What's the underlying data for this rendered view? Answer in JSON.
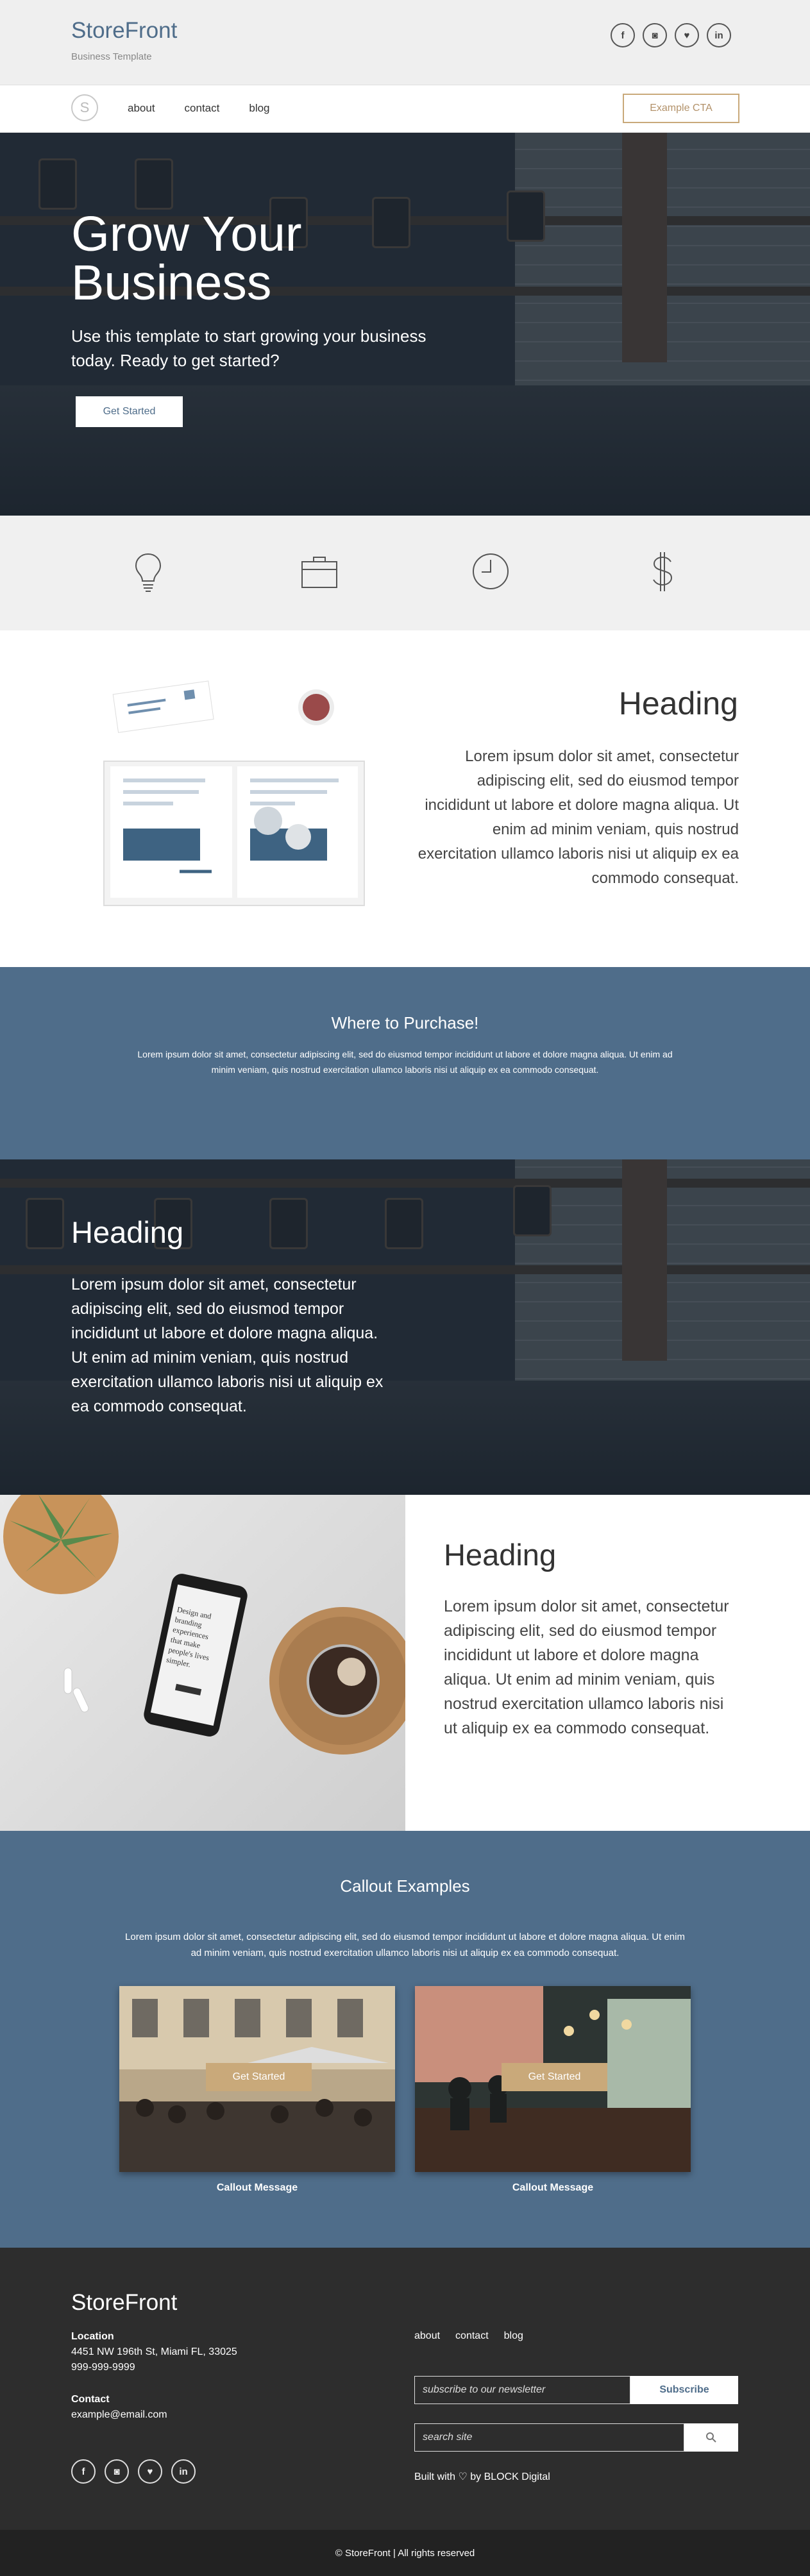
{
  "header": {
    "brand": "StoreFront",
    "tagline": "Business Template",
    "social": [
      {
        "icon": "facebook-icon",
        "glyph": "f"
      },
      {
        "icon": "instagram-icon",
        "glyph": "◙"
      },
      {
        "icon": "twitter-icon",
        "glyph": "♥"
      },
      {
        "icon": "linkedin-icon",
        "glyph": "in"
      }
    ]
  },
  "nav": {
    "logo_letter": "S",
    "links": [
      "about",
      "contact",
      "blog"
    ],
    "cta": "Example CTA"
  },
  "hero": {
    "title": "Grow Your Business",
    "subtitle": "Use this template to start growing your business today. Ready to get started?",
    "button": "Get Started"
  },
  "icons_strip": [
    "lightbulb-icon",
    "briefcase-icon",
    "clock-icon",
    "dollar-icon"
  ],
  "section_one": {
    "heading": "Heading",
    "body": "Lorem ipsum dolor sit amet, consectetur adipiscing elit, sed do eiusmod tempor incididunt ut labore et dolore magna aliqua. Ut enim ad minim veniam, quis nostrud exercitation ullamco laboris nisi ut aliquip ex ea commodo consequat."
  },
  "purchase": {
    "heading": "Where to Purchase!",
    "body": "Lorem ipsum dolor sit amet, consectetur adipiscing elit, sed do eiusmod tempor incididunt ut labore et dolore magna aliqua. Ut enim ad minim veniam, quis nostrud exercitation ullamco laboris nisi ut aliquip ex ea commodo consequat."
  },
  "section_two": {
    "heading": "Heading",
    "body": "Lorem ipsum dolor sit amet, consectetur adipiscing elit, sed do eiusmod tempor incididunt ut labore et dolore magna aliqua. Ut enim ad minim veniam, quis nostrud exercitation ullamco laboris nisi ut aliquip ex ea commodo consequat."
  },
  "section_three": {
    "heading": "Heading",
    "body": "Lorem ipsum dolor sit amet, consectetur adipiscing elit, sed do eiusmod tempor incididunt ut labore et dolore magna aliqua. Ut enim ad minim veniam, quis nostrud exercitation ullamco laboris nisi ut aliquip ex ea commodo consequat."
  },
  "callouts": {
    "heading": "Callout Examples",
    "body": "Lorem ipsum dolor sit amet, consectetur adipiscing elit, sed do eiusmod tempor incididunt ut labore et dolore magna aliqua. Ut enim ad minim veniam, quis nostrud exercitation ullamco laboris nisi ut aliquip ex ea commodo consequat.",
    "cards": [
      {
        "button": "Get Started",
        "message": "Callout Message"
      },
      {
        "button": "Get Started",
        "message": "Callout Message"
      }
    ]
  },
  "footer": {
    "brand": "StoreFront",
    "location_label": "Location",
    "address": "4451 NW 196th St, Miami FL, 33025",
    "phone": "999-999-9999",
    "contact_label": "Contact",
    "email": "example@email.com",
    "links": [
      "about",
      "contact",
      "blog"
    ],
    "newsletter_placeholder": "subscribe to our newsletter",
    "subscribe": "Subscribe",
    "search_placeholder": "search site",
    "built_with": "Built with ♡ by BLOCK Digital",
    "copyright": "© StoreFront | All rights reserved"
  },
  "colors": {
    "brand_blue": "#4f6d8a",
    "gold": "#c9a97a",
    "footer": "#2d2d2d"
  }
}
